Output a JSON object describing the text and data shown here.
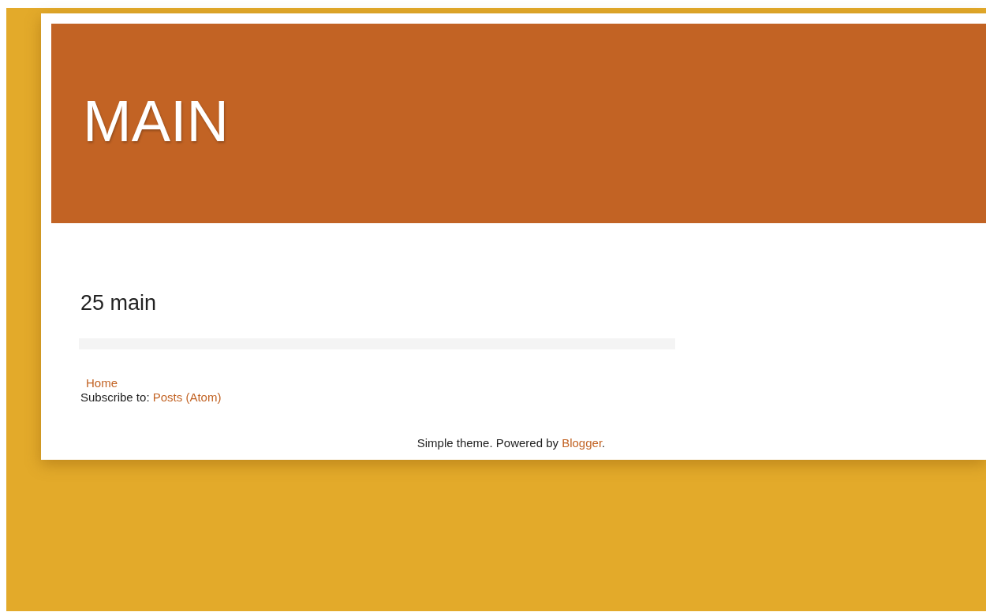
{
  "header": {
    "title": "MAIN"
  },
  "post": {
    "title": "25 main"
  },
  "nav": {
    "home_link": "Home"
  },
  "subscribe": {
    "label": "Subscribe to:",
    "link": "Posts (Atom)"
  },
  "footer": {
    "text": "Simple theme. Powered by",
    "link": "Blogger",
    "end": "."
  }
}
